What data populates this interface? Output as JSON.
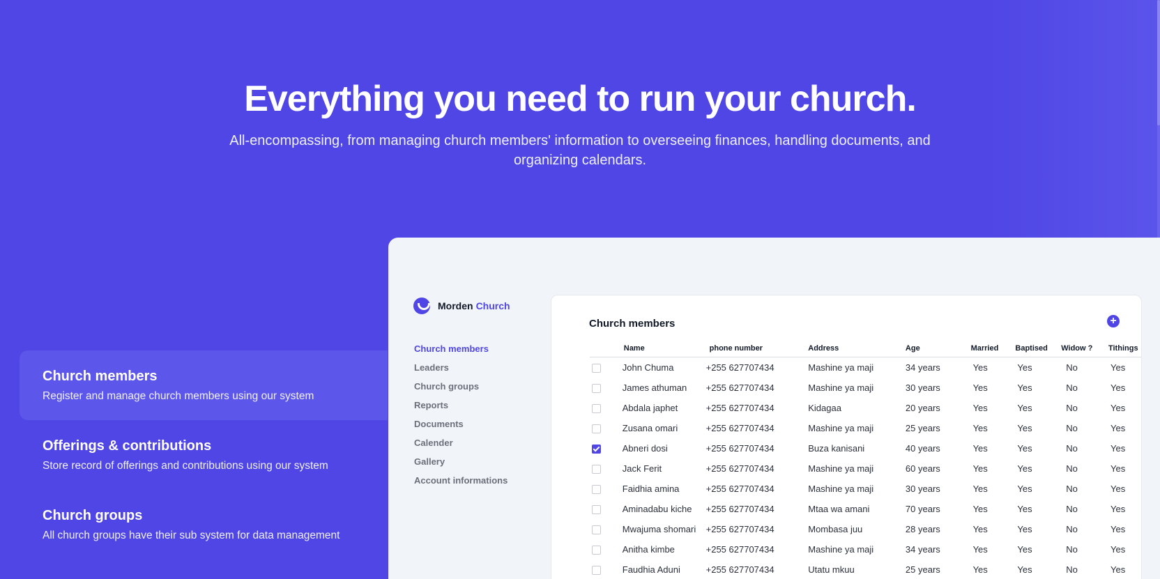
{
  "hero": {
    "title": "Everything you need to run your church.",
    "subtitle": "All-encompassing, from managing church members' information to overseeing finances, handling documents, and organizing calendars."
  },
  "features": [
    {
      "title": "Church members",
      "description": "Register and manage church members using our system",
      "active": true
    },
    {
      "title": "Offerings & contributions",
      "description": "Store record of offerings and contributions using our system",
      "active": false
    },
    {
      "title": "Church groups",
      "description": "All church groups have their sub system for data management",
      "active": false
    }
  ],
  "app": {
    "logo": {
      "part1": "Morden",
      "part2": "Church"
    },
    "nav": [
      "Church members",
      "Leaders",
      "Church groups",
      "Reports",
      "Documents",
      "Calender",
      "Gallery",
      "Account informations"
    ],
    "nav_active": "Church members",
    "card_title": "Church members",
    "add_icon": "plus-circle-icon",
    "columns": [
      "Name",
      "phone number",
      "Address",
      "Age",
      "Married",
      "Baptised",
      "Widow ?",
      "Tithings"
    ],
    "rows": [
      {
        "checked": false,
        "cells": [
          "John Chuma",
          "+255 627707434",
          "Mashine ya maji",
          "34 years",
          "Yes",
          "Yes",
          "No",
          "Yes"
        ]
      },
      {
        "checked": false,
        "cells": [
          "James athuman",
          "+255 627707434",
          "Mashine ya maji",
          "30 years",
          "Yes",
          "Yes",
          "No",
          "Yes"
        ]
      },
      {
        "checked": false,
        "cells": [
          "Abdala japhet",
          "+255 627707434",
          "Kidagaa",
          "20 years",
          "Yes",
          "Yes",
          "No",
          "Yes"
        ]
      },
      {
        "checked": false,
        "cells": [
          "Zusana omari",
          "+255 627707434",
          "Mashine ya maji",
          "25 years",
          "Yes",
          "Yes",
          "No",
          "Yes"
        ]
      },
      {
        "checked": true,
        "cells": [
          "Abneri dosi",
          "+255 627707434",
          "Buza kanisani",
          "40 years",
          "Yes",
          "Yes",
          "No",
          "Yes"
        ]
      },
      {
        "checked": false,
        "cells": [
          "Jack Ferit",
          "+255 627707434",
          "Mashine ya maji",
          "60 years",
          "Yes",
          "Yes",
          "No",
          "Yes"
        ]
      },
      {
        "checked": false,
        "cells": [
          "Faidhia amina",
          "+255 627707434",
          "Mashine ya maji",
          "30 years",
          "Yes",
          "Yes",
          "No",
          "Yes"
        ]
      },
      {
        "checked": false,
        "cells": [
          "Aminadabu kiche",
          "+255 627707434",
          "Mtaa wa amani",
          "70 years",
          "Yes",
          "Yes",
          "No",
          "Yes"
        ]
      },
      {
        "checked": false,
        "cells": [
          "Mwajuma shomari",
          "+255 627707434",
          "Mombasa juu",
          "28 years",
          "Yes",
          "Yes",
          "No",
          "Yes"
        ]
      },
      {
        "checked": false,
        "cells": [
          "Anitha kimbe",
          "+255 627707434",
          "Mashine ya maji",
          "34 years",
          "Yes",
          "Yes",
          "No",
          "Yes"
        ]
      },
      {
        "checked": false,
        "cells": [
          "Faudhia Aduni",
          "+255 627707434",
          "Utatu mkuu",
          "25 years",
          "Yes",
          "Yes",
          "No",
          "Yes"
        ]
      }
    ]
  },
  "colors": {
    "brand": "#4f46e5",
    "panel_bg": "#f1f4f9",
    "card_bg": "#ffffff"
  }
}
